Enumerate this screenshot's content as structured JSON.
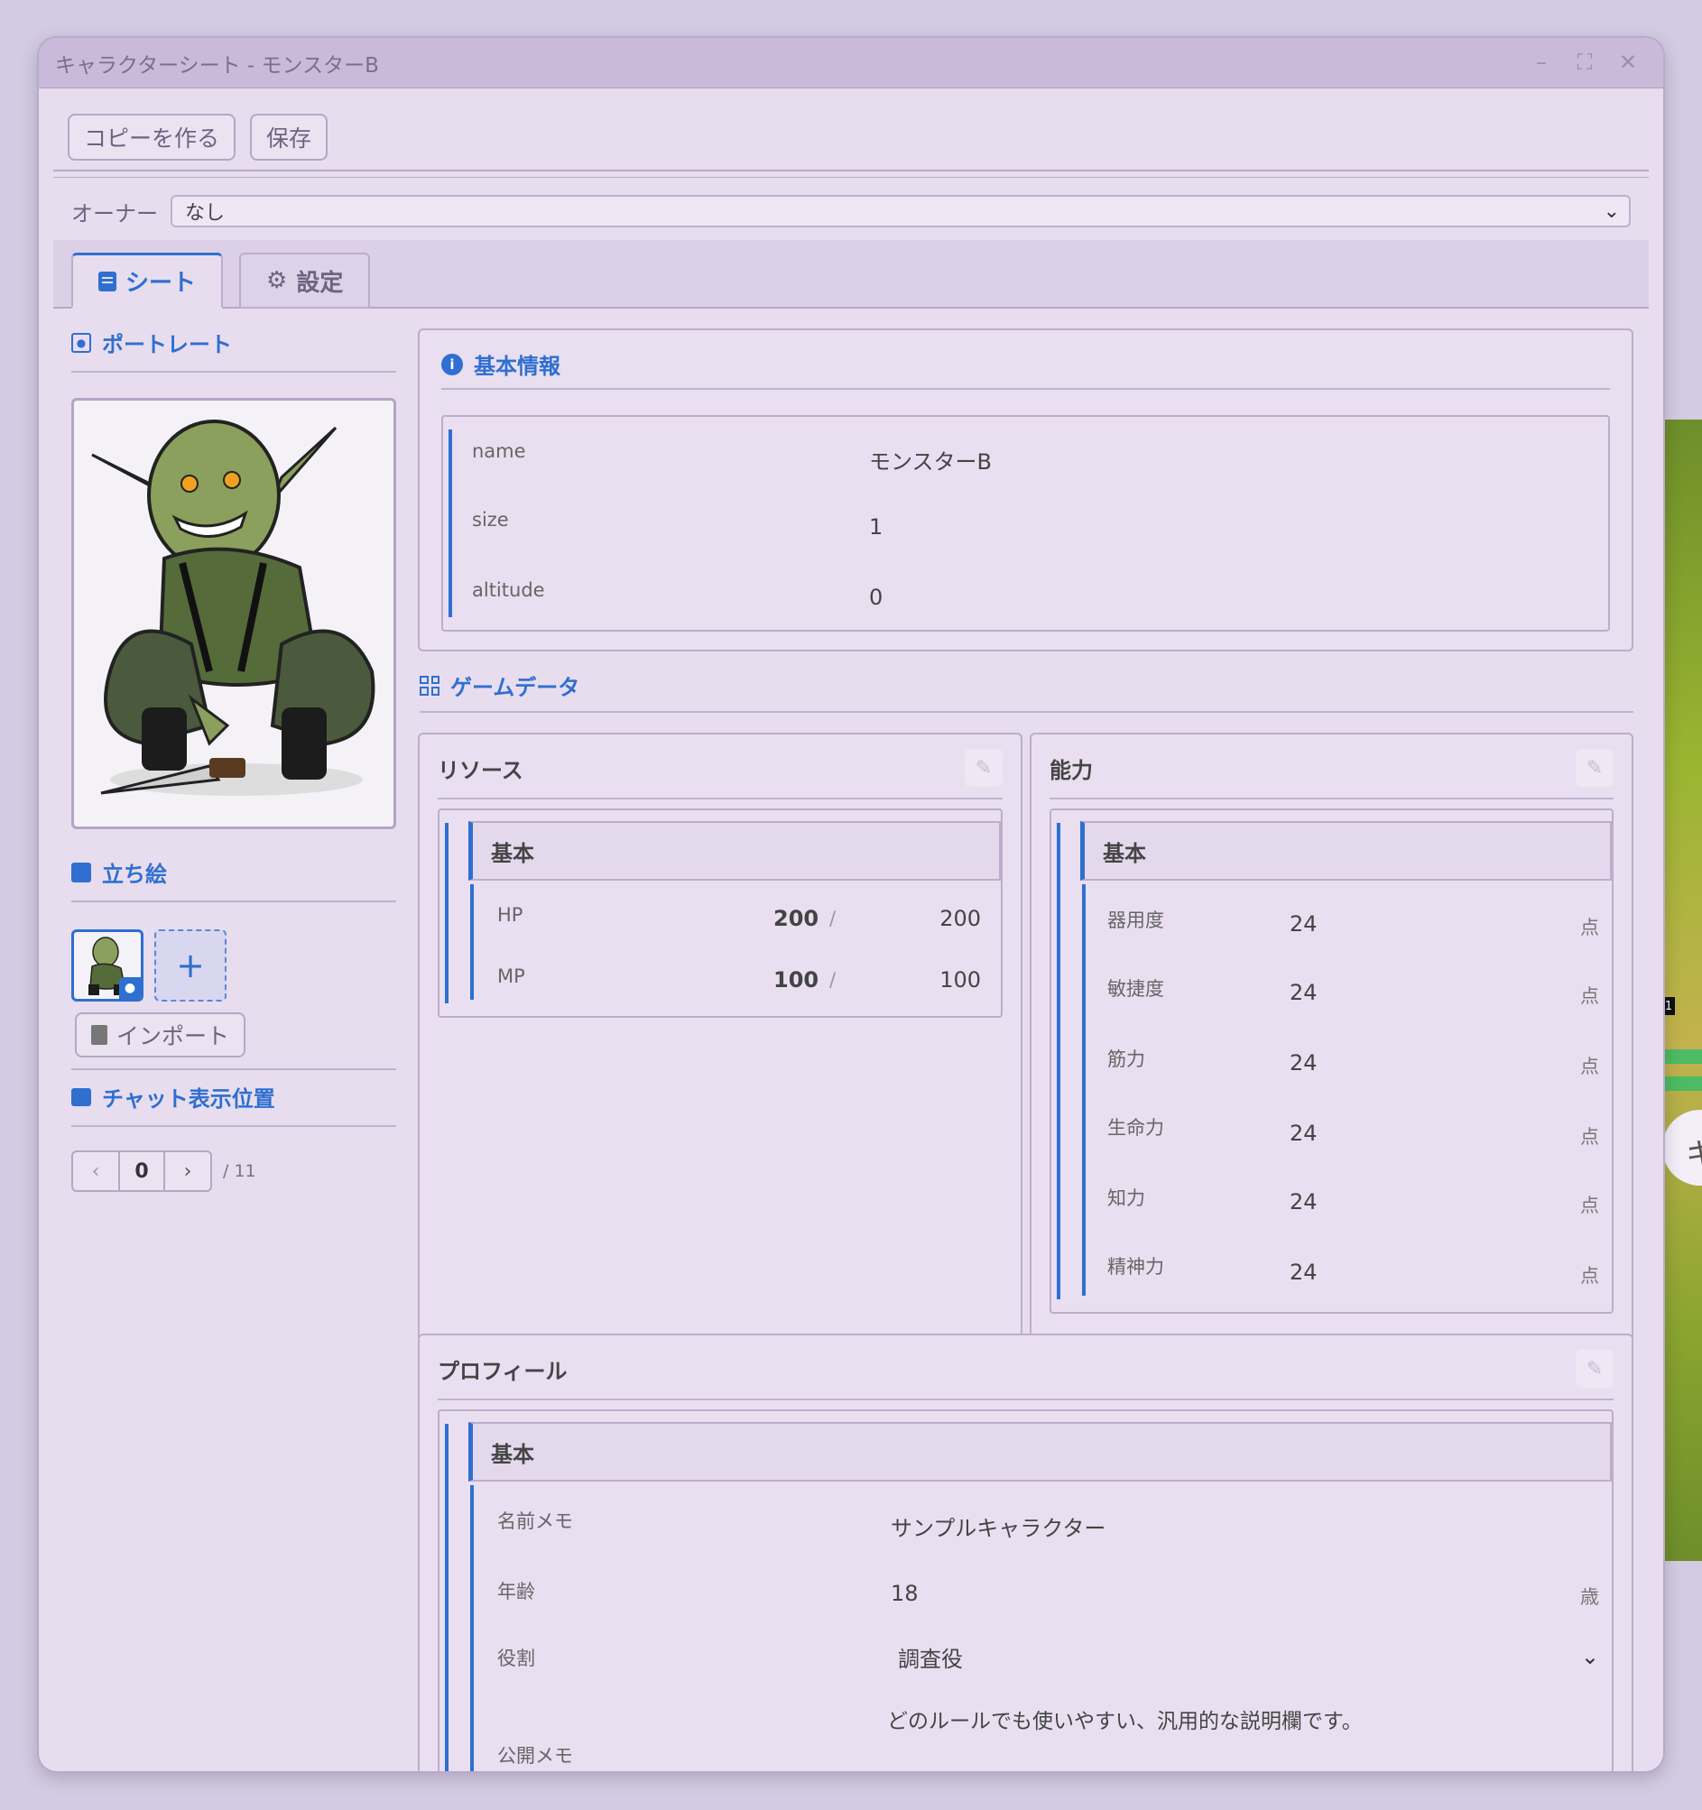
{
  "window": {
    "title": "キャラクターシート - モンスターB"
  },
  "toolbar": {
    "copy_label": "コピーを作る",
    "save_label": "保存"
  },
  "owner": {
    "label": "オーナー",
    "value": "なし"
  },
  "tabs": [
    {
      "label": "シート"
    },
    {
      "label": "設定"
    }
  ],
  "left": {
    "portrait_heading": "ポートレート",
    "standing_heading": "立ち絵",
    "add_label": "+",
    "import_label": "インポート",
    "chat_heading": "チャット表示位置",
    "pager": {
      "prev": "‹",
      "value": "0",
      "next": "›",
      "total": "/ 11"
    }
  },
  "basic": {
    "heading": "基本情報",
    "rows": [
      {
        "label": "name",
        "value": "モンスターB"
      },
      {
        "label": "size",
        "value": "1"
      },
      {
        "label": "altitude",
        "value": "0"
      }
    ]
  },
  "gamedata_heading": "ゲームデータ",
  "resources": {
    "title": "リソース",
    "group": "基本",
    "rows": [
      {
        "label": "HP",
        "current": "200",
        "sep": "/",
        "max": "200"
      },
      {
        "label": "MP",
        "current": "100",
        "sep": "/",
        "max": "100"
      }
    ]
  },
  "abilities": {
    "title": "能力",
    "group": "基本",
    "rows": [
      {
        "label": "器用度",
        "value": "24",
        "unit": "点"
      },
      {
        "label": "敏捷度",
        "value": "24",
        "unit": "点"
      },
      {
        "label": "筋力",
        "value": "24",
        "unit": "点"
      },
      {
        "label": "生命力",
        "value": "24",
        "unit": "点"
      },
      {
        "label": "知力",
        "value": "24",
        "unit": "点"
      },
      {
        "label": "精神力",
        "value": "24",
        "unit": "点"
      }
    ]
  },
  "profile": {
    "title": "プロフィール",
    "group": "基本",
    "name_memo": {
      "label": "名前メモ",
      "value": "サンプルキャラクター"
    },
    "age": {
      "label": "年齢",
      "value": "18",
      "unit": "歳"
    },
    "role": {
      "label": "役割",
      "value": "調査役"
    },
    "public_memo": {
      "label": "公開メモ",
      "value": "どのルールでも使いやすい、汎用的な説明欄です。"
    }
  },
  "background": {
    "chip_text": "キ",
    "token_badge": "1"
  },
  "colors": {
    "accent": "#2f6fd0",
    "window_bg": "#e7ddee",
    "titlebar": "#c9bad9"
  }
}
